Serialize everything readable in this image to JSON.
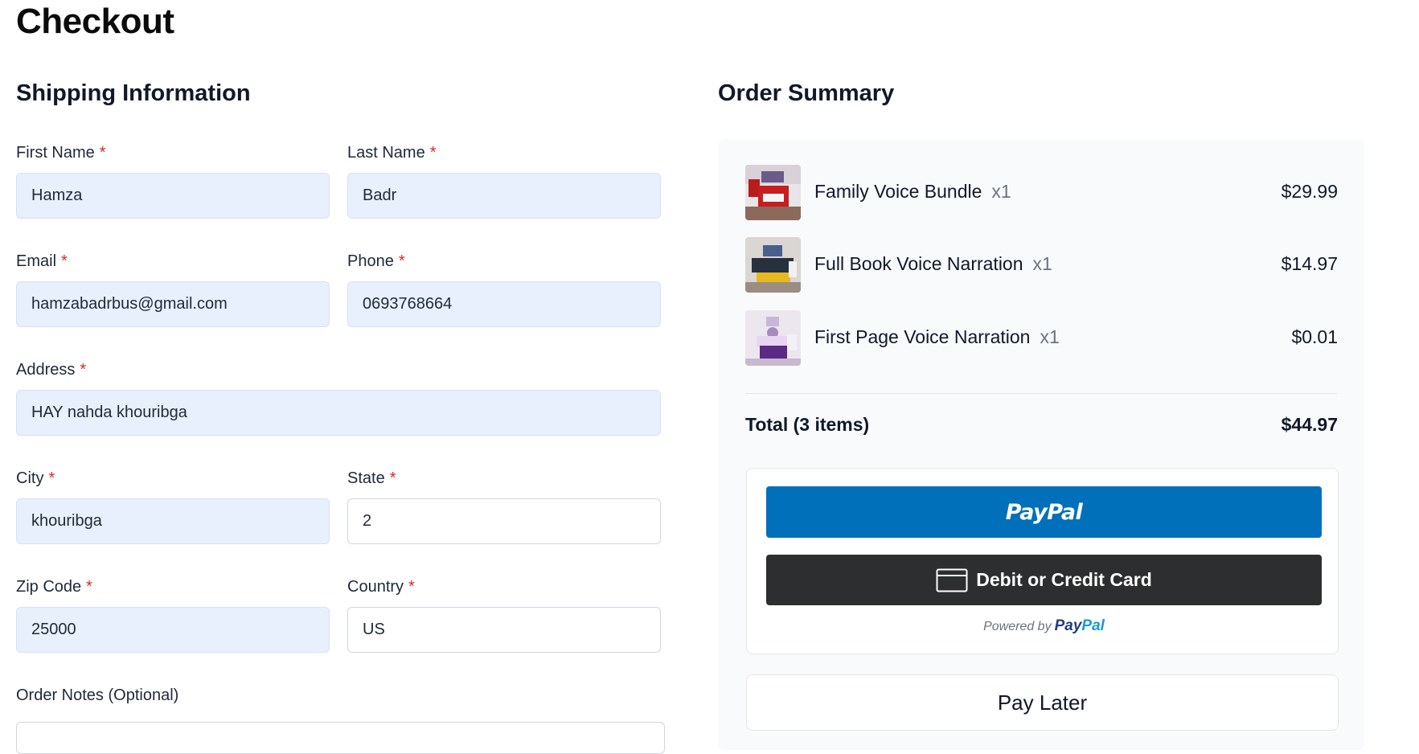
{
  "page": {
    "title": "Checkout"
  },
  "shipping": {
    "title": "Shipping Information",
    "required_mark": "*",
    "first_name": {
      "label": "First Name",
      "value": "Hamza"
    },
    "last_name": {
      "label": "Last Name",
      "value": "Badr"
    },
    "email": {
      "label": "Email",
      "value": "hamzabadrbus@gmail.com"
    },
    "phone": {
      "label": "Phone",
      "value": "0693768664"
    },
    "address": {
      "label": "Address",
      "value": "HAY nahda khouribga"
    },
    "city": {
      "label": "City",
      "value": "khouribga"
    },
    "state": {
      "label": "State",
      "value": "2"
    },
    "zip": {
      "label": "Zip Code",
      "value": "25000"
    },
    "country": {
      "label": "Country",
      "value": "US"
    },
    "notes": {
      "label": "Order Notes (Optional)"
    }
  },
  "summary": {
    "title": "Order Summary",
    "items": [
      {
        "name": "Family Voice Bundle",
        "qty": "x1",
        "price": "$29.99"
      },
      {
        "name": "Full Book Voice Narration",
        "qty": "x1",
        "price": "$14.97"
      },
      {
        "name": "First Page Voice Narration",
        "qty": "x1",
        "price": "$0.01"
      }
    ],
    "total_label": "Total (3 items)",
    "total_value": "$44.97"
  },
  "payment": {
    "paypal_label": "PayPal",
    "card_label": "Debit or Credit Card",
    "powered_by": "Powered by",
    "powered_logo_1": "Pay",
    "powered_logo_2": "Pal",
    "pay_later_label": "Pay Later"
  },
  "colors": {
    "paypal_blue": "#0070ba",
    "card_dark": "#2c2e2f",
    "required_red": "#dc2626",
    "autofill_bg": "#e8f0fe"
  }
}
